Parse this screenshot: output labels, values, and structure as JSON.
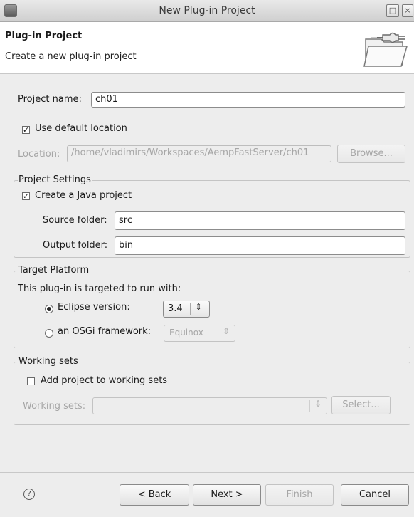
{
  "window": {
    "title": "New Plug-in Project"
  },
  "header": {
    "title": "Plug-in Project",
    "subtitle": "Create a new plug-in project",
    "icon": "plugin-wizard-icon"
  },
  "project_name": {
    "label": "Project name:",
    "value": "ch01"
  },
  "default_location": {
    "label": "Use default location",
    "checked": true
  },
  "location": {
    "label": "Location:",
    "value": "/home/vladimirs/Workspaces/AempFastServer/ch01",
    "browse_label": "Browse..."
  },
  "project_settings": {
    "legend": "Project Settings",
    "java_project": {
      "label": "Create a Java project",
      "checked": true
    },
    "source_folder": {
      "label": "Source folder:",
      "value": "src"
    },
    "output_folder": {
      "label": "Output folder:",
      "value": "bin"
    }
  },
  "target_platform": {
    "legend": "Target Platform",
    "description": "This plug-in is targeted to run with:",
    "eclipse_version": {
      "label": "Eclipse version:",
      "value": "3.4",
      "selected": true
    },
    "osgi_framework": {
      "label": "an OSGi framework:",
      "value": "Equinox",
      "selected": false
    }
  },
  "working_sets": {
    "legend": "Working sets",
    "add_to_sets": {
      "label": "Add project to working sets",
      "checked": false
    },
    "sets_label": "Working sets:",
    "sets_value": "",
    "select_label": "Select..."
  },
  "buttons": {
    "back": "< Back",
    "next": "Next >",
    "finish": "Finish",
    "cancel": "Cancel"
  }
}
